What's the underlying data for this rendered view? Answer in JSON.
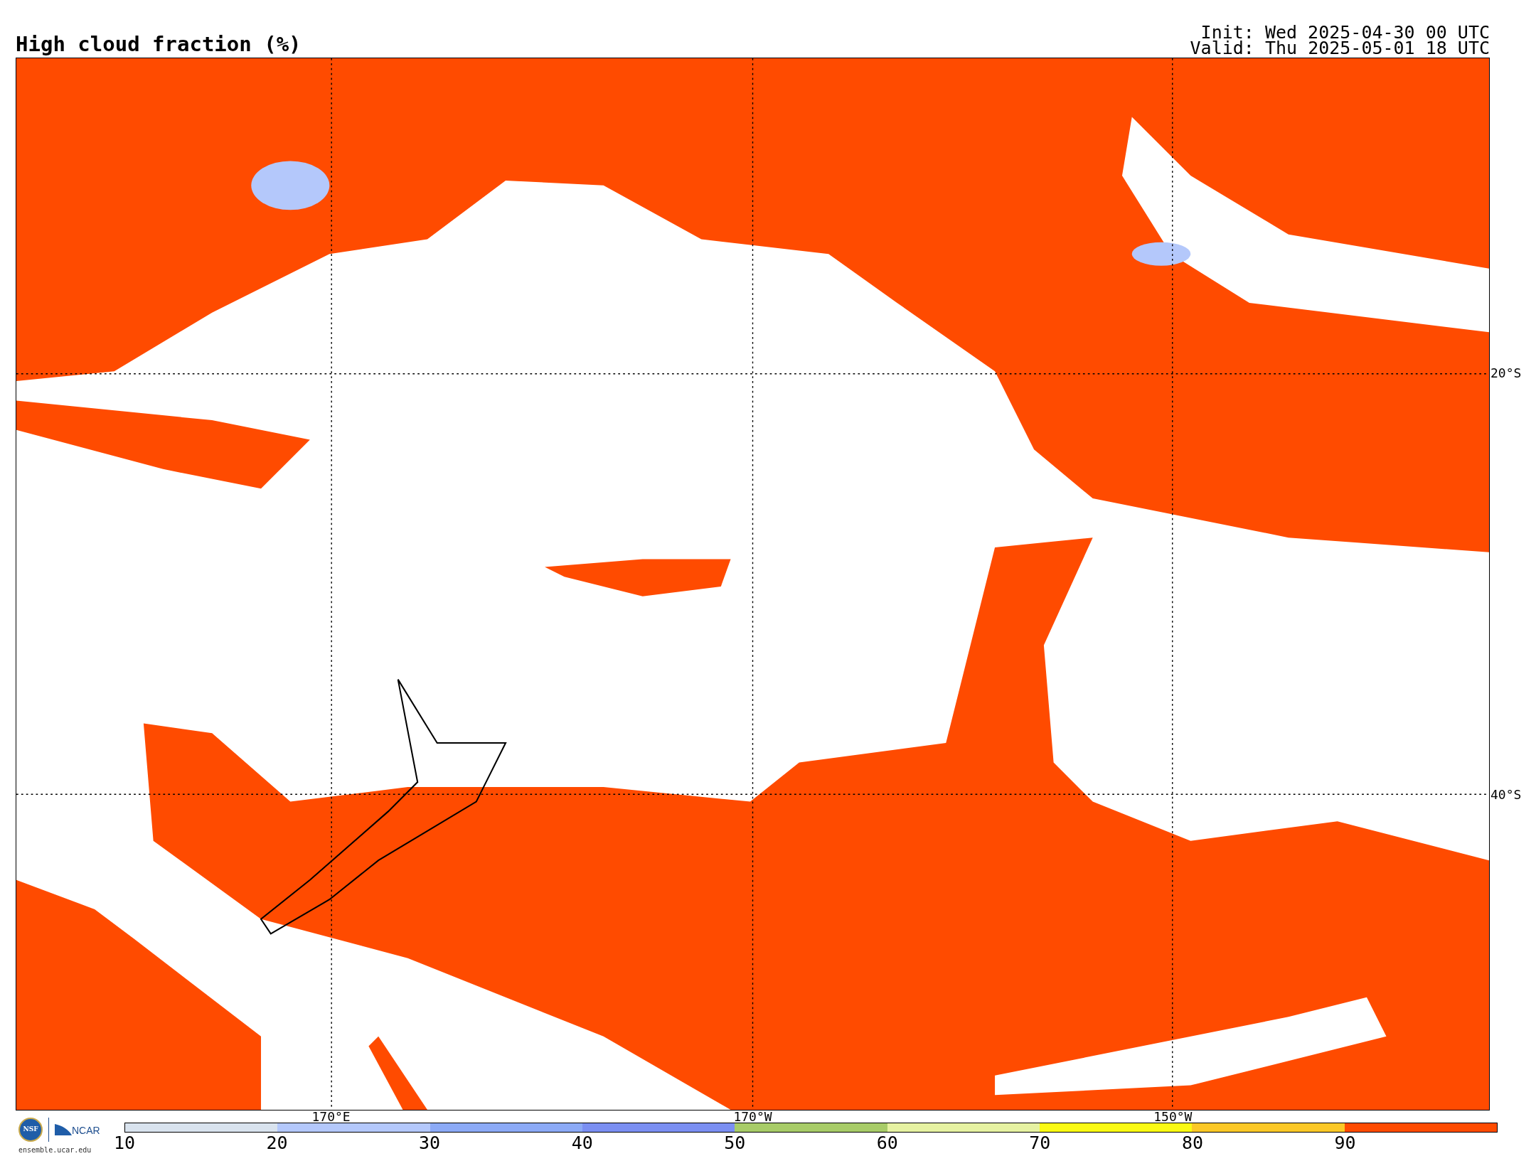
{
  "title": "High cloud fraction (%)",
  "init": "Init: Wed 2025-04-30 00 UTC",
  "valid": "Valid: Thu 2025-05-01 18 UTC",
  "lat_labels": [
    "20°S",
    "40°S"
  ],
  "lon_labels": [
    "170°E",
    "170°W",
    "150°W"
  ],
  "logo": {
    "badge": "NSF",
    "wordmark": "NCAR",
    "url": "ensemble.ucar.edu"
  },
  "colorbar": [
    {
      "label": "10",
      "color": "#d9e3ee"
    },
    {
      "label": "20",
      "color": "#b4c8fb"
    },
    {
      "label": "30",
      "color": "#8caaf6"
    },
    {
      "label": "40",
      "color": "#7b8ff2"
    },
    {
      "label": "50",
      "color": "#a8cc68"
    },
    {
      "label": "60",
      "color": "#e6f2a2"
    },
    {
      "label": "70",
      "color": "#fafa14"
    },
    {
      "label": "80",
      "color": "#fbc827"
    },
    {
      "label": "90",
      "color": "#ff4b00"
    }
  ]
}
